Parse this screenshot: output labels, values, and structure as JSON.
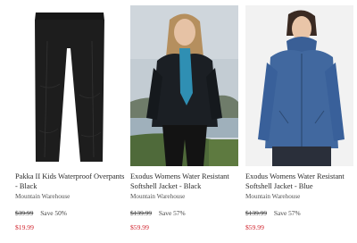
{
  "products": [
    {
      "title": "Pakka II Kids Waterproof Overpants - Black",
      "brand": "Mountain Warehouse",
      "was_price": "$39.99",
      "save": "Save 50%",
      "price": "$19.99"
    },
    {
      "title": "Exodus Womens Water Resistant Softshell Jacket - Black",
      "brand": "Mountain Warehouse",
      "was_price": "$139.99",
      "save": "Save 57%",
      "price": "$59.99"
    },
    {
      "title": "Exodus Womens Water Resistant Softshell Jacket - Blue",
      "brand": "Mountain Warehouse",
      "was_price": "$139.99",
      "save": "Save 57%",
      "price": "$59.99"
    }
  ],
  "colors": {
    "sale_price": "#d0212b",
    "card_bg": "#ffffff"
  }
}
